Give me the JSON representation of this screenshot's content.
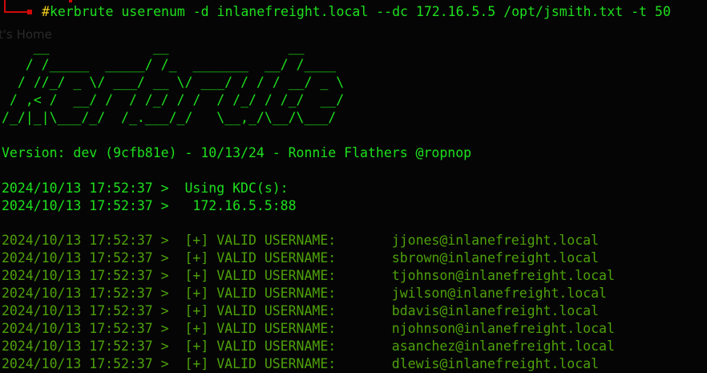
{
  "prompt": {
    "symbol": "#",
    "command": "kerbrute userenum -d inlanefreight.local --dc 172.16.5.5 /opt/jsmith.txt -t 50",
    "color": "#d10a0a"
  },
  "background_ghost_text": [
    "t's Home"
  ],
  "banner": [
    "    __             __               __",
    "   / /_____  _____/ /_  _______  __/ /____",
    "  / //_/ _ \\/ ___/ __ \\/ ___/ / / / __/ _ \\",
    " / ,< /  __/ /  / /_/ / /  / /_/ / /_/  __/",
    "/_/|_|\\___/_/  /_.___/_/   \\__,_/\\__/\\___/"
  ],
  "version_line": "Version: dev (9cfb81e) - 10/13/24 - Ronnie Flathers @ropnop",
  "kdc_lines": [
    "2024/10/13 17:52:37 >  Using KDC(s):",
    "2024/10/13 17:52:37 >   172.16.5.5:88"
  ],
  "valid_prefix": "2024/10/13 17:52:37 >  [+] VALID USERNAME:       ",
  "valid_users": [
    "jjones@inlanefreight.local",
    "sbrown@inlanefreight.local",
    "tjohnson@inlanefreight.local",
    "jwilson@inlanefreight.local",
    "bdavis@inlanefreight.local",
    "njohnson@inlanefreight.local",
    "asanchez@inlanefreight.local",
    "dlewis@inlanefreight.local"
  ],
  "colors": {
    "bright_green": "#1ee01e",
    "dim_green": "#4ea10a",
    "background": "#050505"
  }
}
